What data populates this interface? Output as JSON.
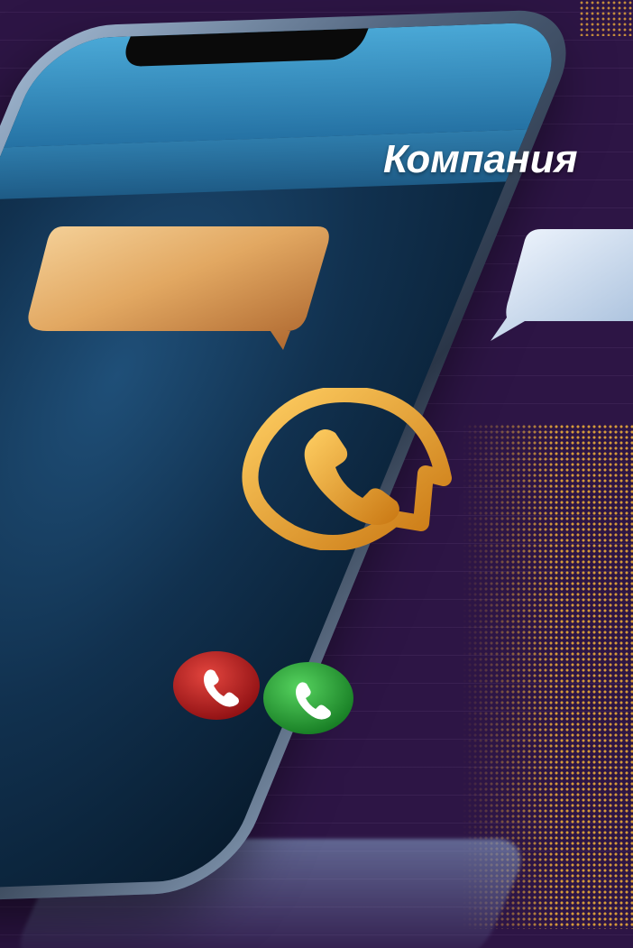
{
  "screen": {
    "title": "Компания"
  },
  "icons": {
    "callback": "phone-callback-icon",
    "decline": "phone-decline-icon",
    "accept": "phone-accept-icon",
    "bubble_left": "chat-bubble-icon",
    "bubble_right": "chat-bubble-icon"
  },
  "colors": {
    "background": "#2d1545",
    "accent_gold": "#e8a93a",
    "decline_red": "#c9201f",
    "accept_green": "#2aa639",
    "screen_blue": "#1f4f78"
  }
}
